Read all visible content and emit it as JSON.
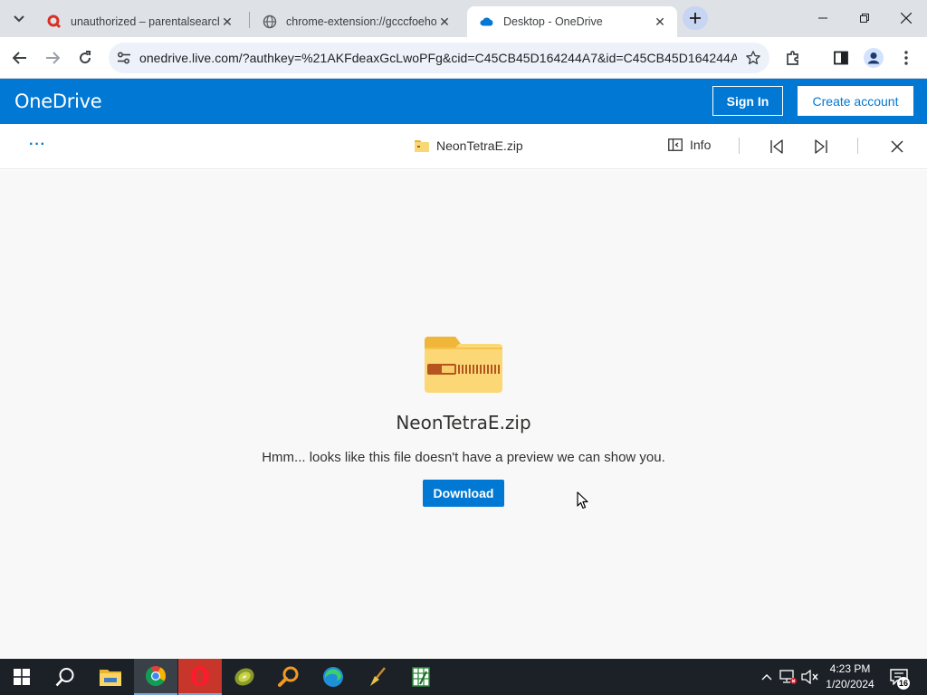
{
  "browser": {
    "tabs": [
      {
        "title": "unauthorized – parentalsearch.",
        "active": false
      },
      {
        "title": "chrome-extension://gcccfoeho",
        "active": false
      },
      {
        "title": "Desktop - OneDrive",
        "active": true
      }
    ],
    "url": "onedrive.live.com/?authkey=%21AKFdeaxGcLwoPFg&cid=C45CB45D164244A7&id=C45CB45D164244A..."
  },
  "onedrive": {
    "brand": "OneDrive",
    "sign_in": "Sign In",
    "create_account": "Create account",
    "accent": "#0078d4"
  },
  "viewer": {
    "more_label": "···",
    "file_name": "NeonTetraE.zip",
    "info_label": "Info",
    "heading": "NeonTetraE.zip",
    "message": "Hmm... looks like this file doesn't have a preview we can show you.",
    "download_label": "Download"
  },
  "taskbar": {
    "time": "4:23 PM",
    "date": "1/20/2024",
    "notifications": "16",
    "apps": [
      "start-icon",
      "search-icon",
      "file-explorer-icon",
      "chrome-icon",
      "opera-icon",
      "kiwi-icon",
      "magnifier-icon",
      "edge-icon",
      "broom-icon",
      "spreadsheet-icon"
    ]
  }
}
